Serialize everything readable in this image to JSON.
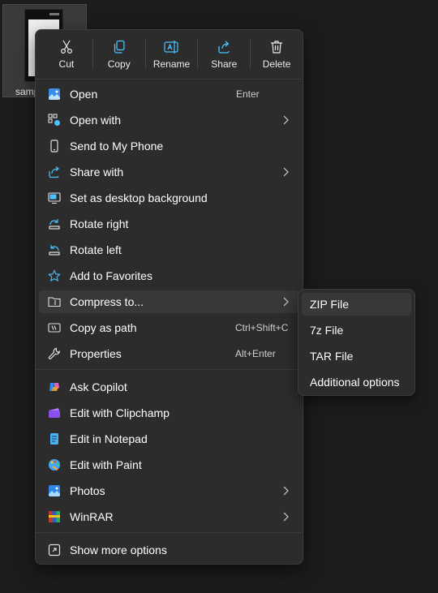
{
  "file": {
    "name_partial": "samp"
  },
  "toolbar": [
    {
      "id": "cut",
      "label": "Cut",
      "icon": "scissors-icon"
    },
    {
      "id": "copy",
      "label": "Copy",
      "icon": "copy-icon"
    },
    {
      "id": "rename",
      "label": "Rename",
      "icon": "rename-icon"
    },
    {
      "id": "share",
      "label": "Share",
      "icon": "share-icon"
    },
    {
      "id": "delete",
      "label": "Delete",
      "icon": "trash-icon"
    }
  ],
  "menu": {
    "open": {
      "label": "Open",
      "shortcut": "Enter"
    },
    "open_with": {
      "label": "Open with"
    },
    "send_to_phone": {
      "label": "Send to My Phone"
    },
    "share_with": {
      "label": "Share with"
    },
    "set_background": {
      "label": "Set as desktop background"
    },
    "rotate_right": {
      "label": "Rotate right"
    },
    "rotate_left": {
      "label": "Rotate left"
    },
    "add_favorites": {
      "label": "Add to Favorites"
    },
    "compress_to": {
      "label": "Compress to..."
    },
    "copy_as_path": {
      "label": "Copy as path",
      "shortcut": "Ctrl+Shift+C"
    },
    "properties": {
      "label": "Properties",
      "shortcut": "Alt+Enter"
    },
    "ask_copilot": {
      "label": "Ask Copilot"
    },
    "clipchamp": {
      "label": "Edit with Clipchamp"
    },
    "notepad": {
      "label": "Edit in Notepad"
    },
    "paint": {
      "label": "Edit with Paint"
    },
    "photos": {
      "label": "Photos"
    },
    "winrar": {
      "label": "WinRAR"
    },
    "show_more": {
      "label": "Show more options"
    }
  },
  "submenu": {
    "zip": {
      "label": "ZIP File"
    },
    "sevenz": {
      "label": "7z File"
    },
    "tar": {
      "label": "TAR File"
    },
    "additional": {
      "label": "Additional options"
    }
  },
  "colors": {
    "menu_bg": "#2c2c2c",
    "hover_bg": "#383838",
    "accent_blue": "#4cc2ff",
    "text": "#ffffff"
  }
}
